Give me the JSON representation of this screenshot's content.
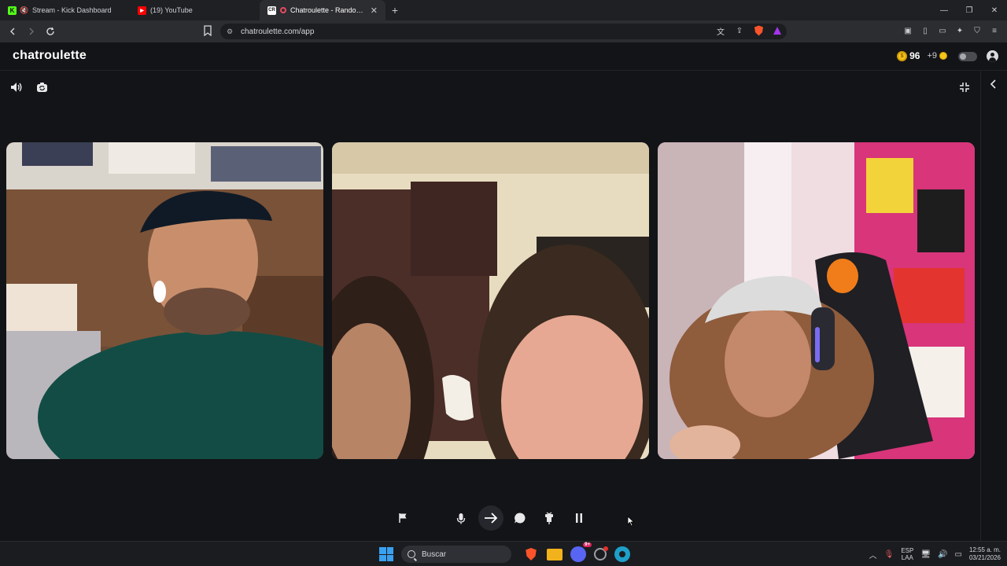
{
  "browser": {
    "tabs": [
      {
        "title": "Stream - Kick Dashboard",
        "favicon": "kick-icon",
        "color": "#53fc18",
        "active": false
      },
      {
        "title": "(19) YouTube",
        "favicon": "youtube-icon",
        "color": "#ff0000",
        "active": false
      },
      {
        "title": "Chatroulette - Random video",
        "favicon": "chatroulette-icon",
        "color": "#ffffff",
        "active": true
      }
    ],
    "new_tab_label": "+",
    "url": "chatroulette.com/app"
  },
  "site": {
    "logo": "chatroulette",
    "coins": "96",
    "bonus": "+9"
  },
  "taskbar": {
    "search_placeholder": "Buscar",
    "discord_badge": "9+",
    "lang_top": "ESP",
    "lang_bottom": "LAA",
    "time": "12:55 a. m.",
    "date": "03/21/2026"
  },
  "colors": {
    "page_bg": "#131417",
    "accent_coin": "#f5c518",
    "brave": "#fb542b"
  }
}
